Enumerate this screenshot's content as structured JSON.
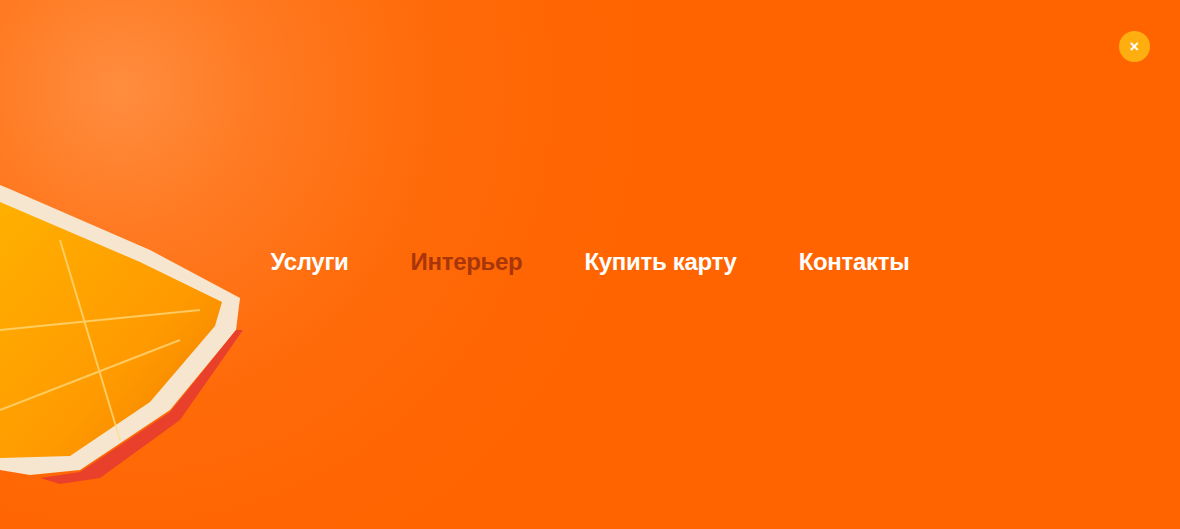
{
  "menu": {
    "items": [
      {
        "label": "Услуги",
        "selected": false
      },
      {
        "label": "Интерьер",
        "selected": true
      },
      {
        "label": "Купить карту",
        "selected": false
      },
      {
        "label": "Контакты",
        "selected": false
      }
    ]
  },
  "close_button": {
    "label": "×"
  }
}
